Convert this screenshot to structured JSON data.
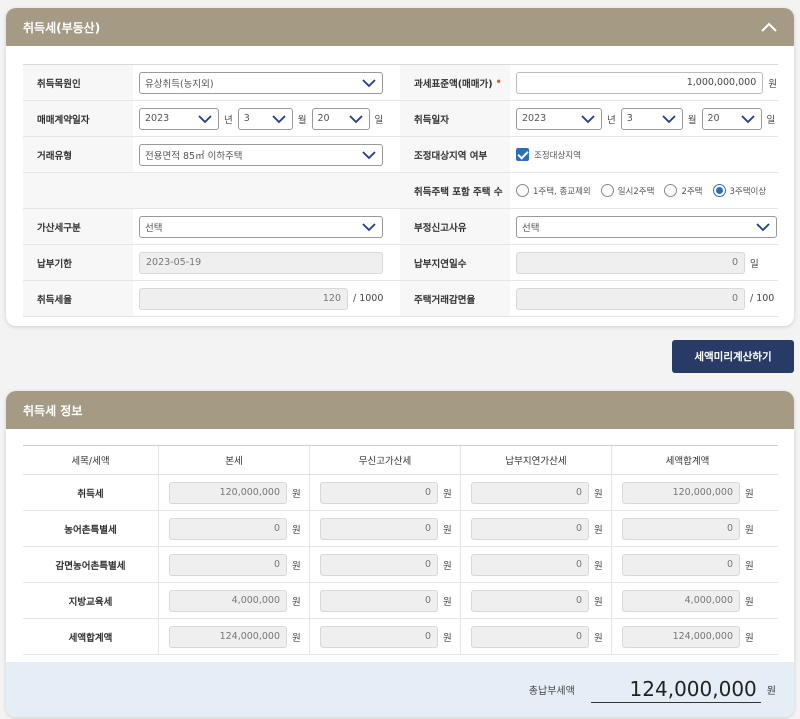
{
  "panel1": {
    "title": "취득세(부동산)",
    "rows": {
      "cause_label": "취득목원인",
      "cause_value": "유상취득(농지외)",
      "base_label": "과세표준액(매매가)",
      "base_req": "•",
      "base_value": "1,000,000,000",
      "contract_label": "매매계약일자",
      "contract_year": "2023",
      "contract_month": "3",
      "contract_day": "20",
      "acq_label": "취득일자",
      "acq_year": "2023",
      "acq_month": "3",
      "acq_day": "20",
      "deal_label": "거래유형",
      "deal_value": "전용면적 85㎡ 이하주택",
      "adj_label": "조정대상지역 여부",
      "adj_value": "조정대상지역",
      "house_label": "취득주택 포함 주택 수",
      "house_options": [
        "1주택, 종교제외",
        "일시2주택",
        "2주택",
        "3주택이상"
      ],
      "addtax_label": "가산세구분",
      "addtax_value": "선택",
      "improper_label": "부정신고사유",
      "improper_value": "선택",
      "due_label": "납부기한",
      "due_value": "2023-05-19",
      "delay_label": "납부지연일수",
      "delay_value": "0",
      "rate_label": "취득세율",
      "rate_value": "120",
      "rate_unit": "/ 1000",
      "reduce_label": "주택거래감면율",
      "reduce_value": "0",
      "reduce_unit": "/ 100"
    },
    "units": {
      "won": "원",
      "year": "년",
      "month": "월",
      "day": "일"
    }
  },
  "calc_button": "세액미리계산하기",
  "panel2": {
    "title": "취득세 정보",
    "headers": [
      "세목/세액",
      "본세",
      "무신고가산세",
      "납부지연가산세",
      "세액합계액"
    ],
    "rows": [
      {
        "name": "취득세",
        "values": [
          "120,000,000",
          "0",
          "0",
          "120,000,000"
        ]
      },
      {
        "name": "농어촌특별세",
        "values": [
          "0",
          "0",
          "0",
          "0"
        ]
      },
      {
        "name": "감면농어촌특별세",
        "values": [
          "0",
          "0",
          "0",
          "0"
        ]
      },
      {
        "name": "지방교육세",
        "values": [
          "4,000,000",
          "0",
          "0",
          "4,000,000"
        ]
      },
      {
        "name": "세액합계액",
        "values": [
          "124,000,000",
          "0",
          "0",
          "124,000,000"
        ]
      }
    ],
    "unit": "원",
    "total_label": "총납부세액",
    "total_value": "124,000,000",
    "total_unit": "원"
  }
}
